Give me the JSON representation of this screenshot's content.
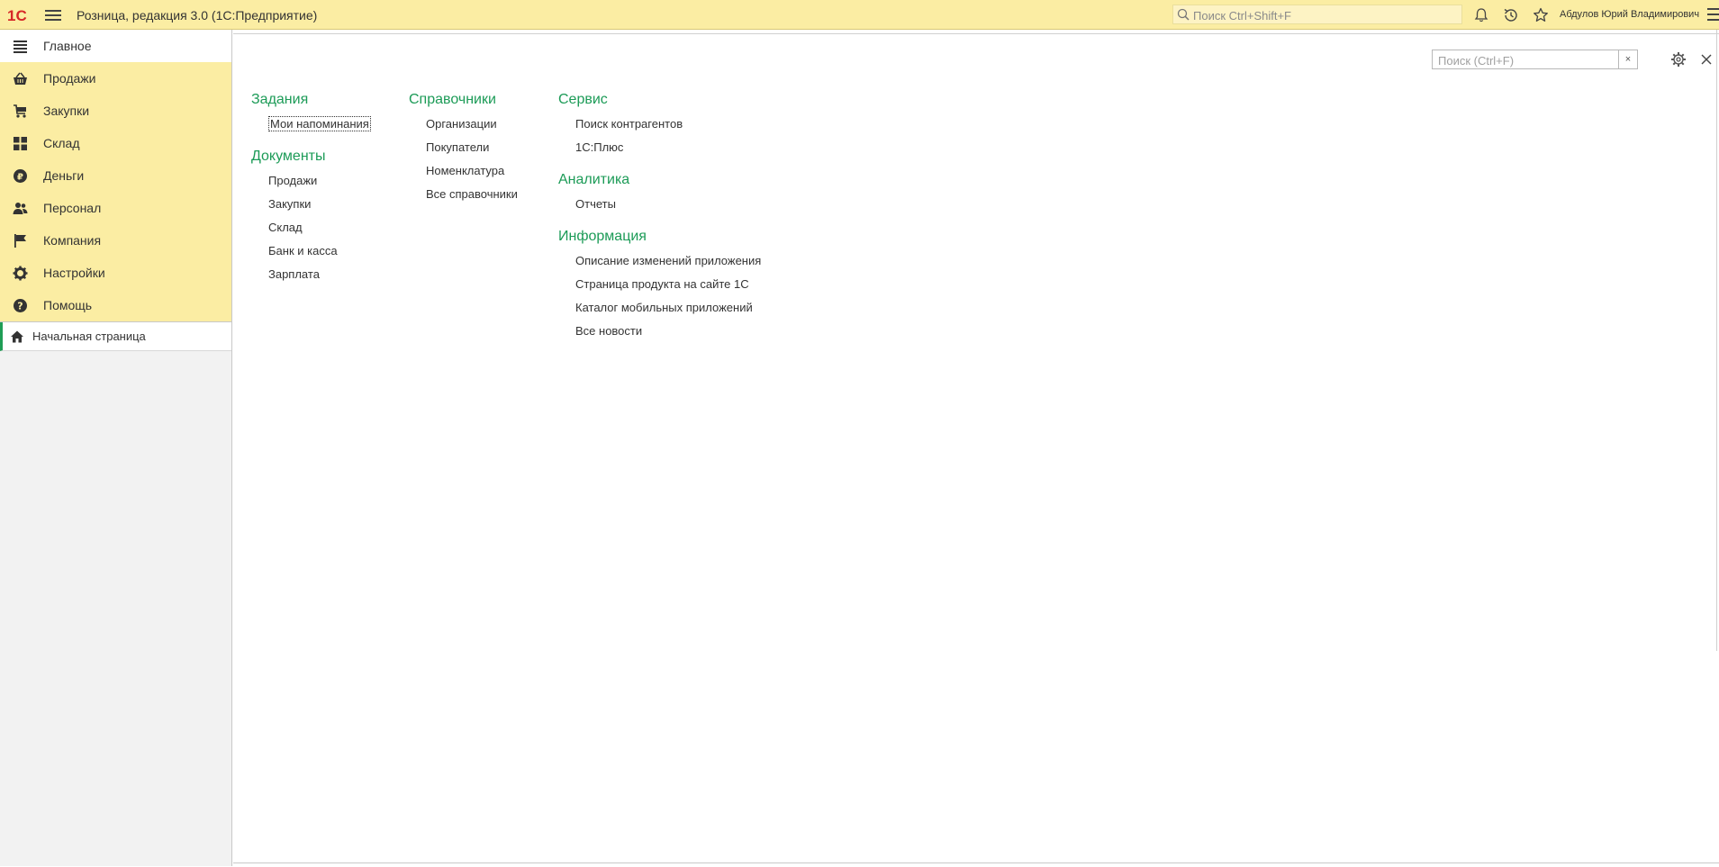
{
  "topbar": {
    "logo_text": "1С",
    "app_title": "Розница, редакция 3.0  (1С:Предприятие)",
    "search_placeholder": "Поиск Ctrl+Shift+F",
    "user_name": "Абдулов Юрий Владимирович"
  },
  "sidebar": {
    "sections": [
      {
        "label": "Главное",
        "icon": "list-icon",
        "active": true
      },
      {
        "label": "Продажи",
        "icon": "basket-icon"
      },
      {
        "label": "Закупки",
        "icon": "cart-icon"
      },
      {
        "label": "Склад",
        "icon": "grid-icon"
      },
      {
        "label": "Деньги",
        "icon": "ruble-coin-icon"
      },
      {
        "label": "Персонал",
        "icon": "people-icon"
      },
      {
        "label": "Компания",
        "icon": "flag-icon"
      },
      {
        "label": "Настройки",
        "icon": "gear-icon"
      },
      {
        "label": "Помощь",
        "icon": "help-icon"
      }
    ],
    "open_pages": [
      {
        "label": "Начальная страница",
        "icon": "home-icon"
      }
    ]
  },
  "main": {
    "search_placeholder": "Поиск (Ctrl+F)",
    "clear_label": "×",
    "columns": [
      {
        "groups": [
          {
            "title": "Задания",
            "items": [
              "Мои напоминания"
            ]
          },
          {
            "title": "Документы",
            "items": [
              "Продажи",
              "Закупки",
              "Склад",
              "Банк и касса",
              "Зарплата"
            ]
          }
        ]
      },
      {
        "groups": [
          {
            "title": "Справочники",
            "items": [
              "Организации",
              "Покупатели",
              "Номенклатура",
              "Все справочники"
            ]
          }
        ]
      },
      {
        "groups": [
          {
            "title": "Сервис",
            "items": [
              "Поиск контрагентов",
              "1С:Плюс"
            ]
          },
          {
            "title": "Аналитика",
            "items": [
              "Отчеты"
            ]
          },
          {
            "title": "Информация",
            "items": [
              "Описание изменений приложения",
              "Страница продукта на сайте 1С",
              "Каталог мобильных приложений",
              "Все новости"
            ]
          }
        ]
      }
    ]
  },
  "colors": {
    "topbar_bg": "#fbeda3",
    "group_title": "#1c9b57",
    "logo_red": "#d62828"
  }
}
